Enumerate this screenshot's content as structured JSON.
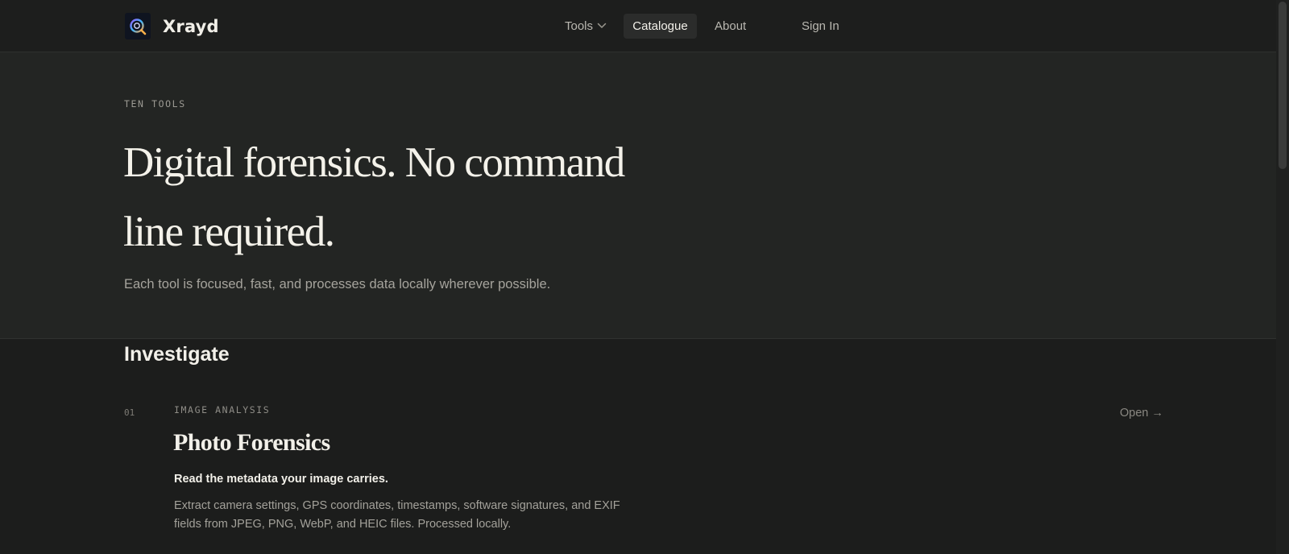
{
  "header": {
    "brand": "Xrayd",
    "logo_icon": "magnifier-icon",
    "nav": {
      "tools": "Tools",
      "catalogue": "Catalogue",
      "about": "About",
      "sign_in": "Sign In"
    },
    "active_nav": "Catalogue"
  },
  "hero": {
    "eyebrow": "TEN TOOLS",
    "title": "Digital forensics. No command line required.",
    "subtitle": "Each tool is focused, fast, and processes data locally wherever possible."
  },
  "section": {
    "title": "Investigate",
    "tools": [
      {
        "number": "01",
        "category": "IMAGE ANALYSIS",
        "name": "Photo Forensics",
        "tagline": "Read the metadata your image carries.",
        "description": "Extract camera settings, GPS coordinates, timestamps, software signatures, and EXIF fields from JPEG, PNG, WebP, and HEIC files. Processed locally.",
        "open_label": "Open →"
      }
    ]
  },
  "colors": {
    "background": "#1c1d1c",
    "hero_background": "#232523",
    "text_primary": "#f2f0e9",
    "text_muted": "#a3a19a",
    "logo_accent": "#6b7cff"
  }
}
